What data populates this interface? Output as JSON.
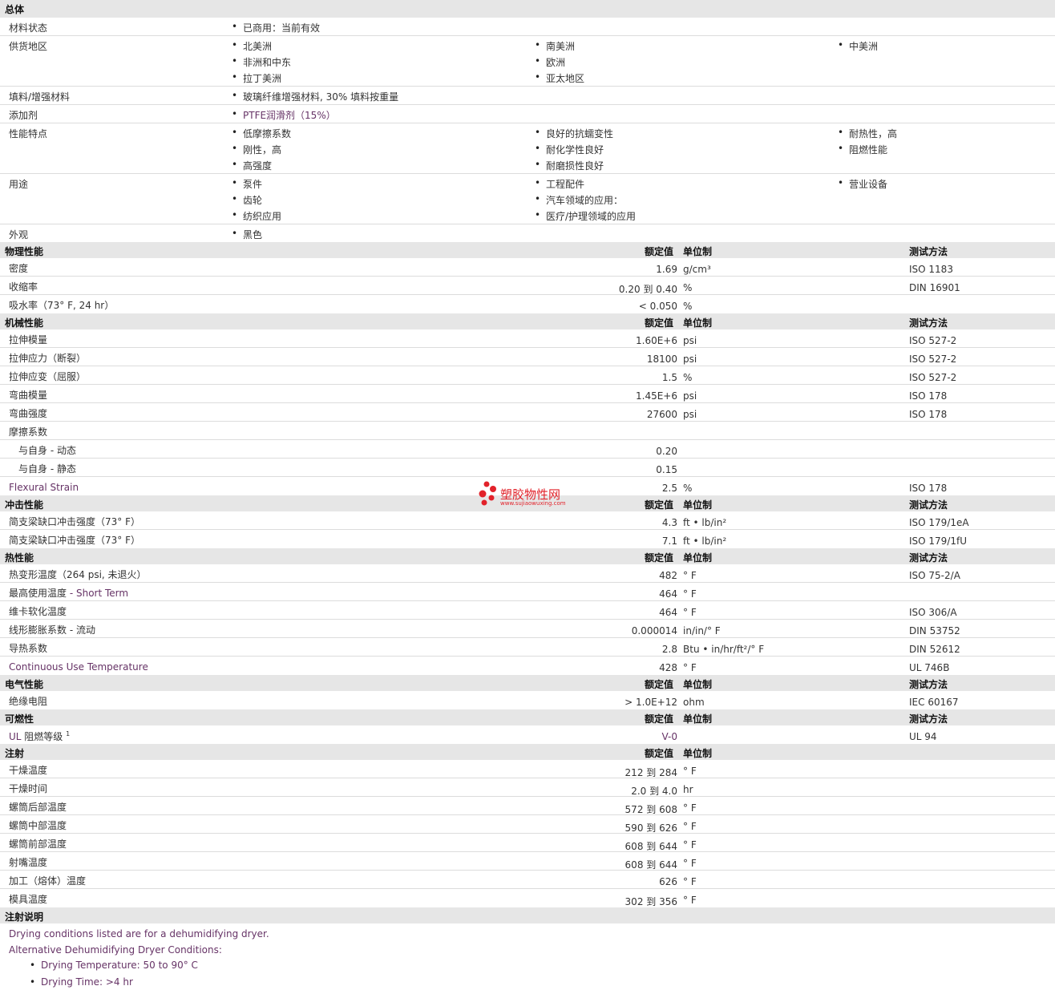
{
  "general": {
    "title": "总体",
    "material_status": {
      "label": "材料状态",
      "items": [
        "已商用：当前有效"
      ]
    },
    "regions": {
      "label": "供货地区",
      "col1": [
        "北美洲",
        "非洲和中东",
        "拉丁美洲"
      ],
      "col2": [
        "南美洲",
        "欧洲",
        "亚太地区"
      ],
      "col3": [
        "中美洲"
      ]
    },
    "filler": {
      "label": "填料/增强材料",
      "items": [
        "玻璃纤维增强材料, 30% 填料按重量"
      ]
    },
    "additive": {
      "label": "添加剂",
      "items": [
        "PTFE润滑剂（15%）"
      ]
    },
    "features": {
      "label": "性能特点",
      "col1": [
        "低摩擦系数",
        "刚性，高",
        "高强度"
      ],
      "col2": [
        "良好的抗蠕变性",
        "耐化学性良好",
        "耐磨损性良好"
      ],
      "col3": [
        "耐热性，高",
        "阻燃性能"
      ]
    },
    "uses": {
      "label": "用途",
      "col1": [
        "泵件",
        "齿轮",
        "纺织应用"
      ],
      "col2": [
        "工程配件",
        "汽车领域的应用：",
        "医疗/护理领域的应用"
      ],
      "col3": [
        "营业设备"
      ]
    },
    "appearance": {
      "label": "外观",
      "items": [
        "黑色"
      ]
    }
  },
  "headers": {
    "nominal": "额定值",
    "unit": "单位制",
    "method": "测试方法"
  },
  "physical": {
    "title": "物理性能",
    "rows": [
      {
        "label": "密度",
        "value": "1.69",
        "unit": "g/cm³",
        "method": "ISO 1183"
      },
      {
        "label": "收缩率",
        "value": "0.20 到  0.40",
        "unit": "%",
        "method": "DIN 16901"
      },
      {
        "label": "吸水率（73°  F, 24 hr）",
        "value": "< 0.050",
        "unit": "%",
        "method": ""
      }
    ]
  },
  "mechanical": {
    "title": "机械性能",
    "rows": [
      {
        "label": "拉伸模量",
        "value": "1.60E+6",
        "unit": "psi",
        "method": "ISO 527-2"
      },
      {
        "label": "拉伸应力（断裂）",
        "value": "18100",
        "unit": "psi",
        "method": "ISO 527-2"
      },
      {
        "label": "拉伸应变（屈服）",
        "value": "1.5",
        "unit": "%",
        "method": "ISO 527-2"
      },
      {
        "label": "弯曲模量",
        "value": "1.45E+6",
        "unit": "psi",
        "method": "ISO 178"
      },
      {
        "label": "弯曲强度",
        "value": "27600",
        "unit": "psi",
        "method": "ISO 178"
      },
      {
        "label": "摩擦系数",
        "value": "",
        "unit": "",
        "method": ""
      },
      {
        "label": "与自身  - 动态",
        "value": "0.20",
        "unit": "",
        "method": ""
      },
      {
        "label": "与自身  - 静态",
        "value": "0.15",
        "unit": "",
        "method": ""
      },
      {
        "label": "Flexural Strain",
        "value": "2.5",
        "unit": "%",
        "method": "ISO 178"
      }
    ]
  },
  "impact": {
    "title": "冲击性能",
    "rows": [
      {
        "label": "简支梁缺口冲击强度（73°  F）",
        "value": "4.3",
        "unit": "ft • lb/in²",
        "method": "ISO 179/1eA"
      },
      {
        "label": "简支梁缺口冲击强度（73°  F）",
        "value": "7.1",
        "unit": "ft • lb/in²",
        "method": "ISO 179/1fU"
      }
    ]
  },
  "thermal": {
    "title": "热性能",
    "rows": [
      {
        "label": "热变形温度（264 psi, 未退火）",
        "value": "482",
        "unit": "°  F",
        "method": "ISO 75-2/A"
      },
      {
        "label": "最高使用温度",
        "label_extra": "- Short Term",
        "value": "464",
        "unit": "°  F",
        "method": ""
      },
      {
        "label": "维卡软化温度",
        "value": "464",
        "unit": "°  F",
        "method": "ISO 306/A"
      },
      {
        "label": "线形膨胀系数  - 流动",
        "value": "0.000014",
        "unit": "in/in/°  F",
        "method": "DIN 53752"
      },
      {
        "label": "导热系数",
        "value": "2.8",
        "unit": "Btu • in/hr/ft²/°  F",
        "method": "DIN 52612"
      },
      {
        "label": "Continuous Use Temperature",
        "value": "428",
        "unit": "°  F",
        "method": "UL 746B"
      }
    ]
  },
  "electrical": {
    "title": "电气性能",
    "rows": [
      {
        "label": "绝缘电阻",
        "value": "> 1.0E+12",
        "unit": "ohm",
        "method": "IEC 60167"
      }
    ]
  },
  "flammability": {
    "title": "可燃性",
    "rows": [
      {
        "label_link": "UL",
        "label": "阻燃等级",
        "sup": "1",
        "value": "V-0",
        "unit": "",
        "method": "UL 94"
      }
    ]
  },
  "injection": {
    "title": "注射",
    "rows": [
      {
        "label": "干燥温度",
        "value": "212 到  284",
        "unit": "°  F"
      },
      {
        "label": "干燥时间",
        "value": "2.0 到  4.0",
        "unit": "hr"
      },
      {
        "label": "螺筒后部温度",
        "value": "572 到  608",
        "unit": "°  F"
      },
      {
        "label": "螺筒中部温度",
        "value": "590 到  626",
        "unit": "°  F"
      },
      {
        "label": "螺筒前部温度",
        "value": "608 到  644",
        "unit": "°  F"
      },
      {
        "label": "射嘴温度",
        "value": "608 到  644",
        "unit": "°  F"
      },
      {
        "label": "加工（熔体）温度",
        "value": "626",
        "unit": "°  F"
      },
      {
        "label": "模具温度",
        "value": "302 到  356",
        "unit": "°  F"
      }
    ]
  },
  "notes": {
    "title": "注射说明",
    "p1": "Drying conditions listed are for a dehumidifying dryer.",
    "p2": "Alternative Dehumidifying Dryer Conditions:",
    "items": [
      "Drying Temperature: 50 to 90°  C",
      "Drying Time: >4 hr"
    ]
  },
  "watermark": {
    "cn": "塑胶物性网",
    "en": "www.sujiaowuxing.com"
  }
}
